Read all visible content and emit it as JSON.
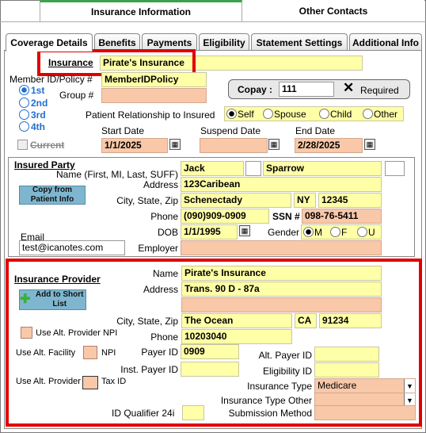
{
  "top_tabs": [
    "Insurance Information",
    "Other Contacts"
  ],
  "sub_tabs": [
    "Coverage Details",
    "Benefits",
    "Payments",
    "Eligibility",
    "Statement Settings",
    "Additional Info"
  ],
  "insurance": {
    "label": "Insurance",
    "value": "Pirate's Insurance"
  },
  "member": {
    "label": "Member ID/Policy #",
    "value": "MemberIDPolicy",
    "group_label": "Group #",
    "priorities": [
      "1st",
      "2nd",
      "3rd",
      "4th"
    ],
    "selected_priority": "1st"
  },
  "copay": {
    "label": "Copay :",
    "value": "111",
    "required_label": "Required",
    "x_icon": "close-icon"
  },
  "relationship": {
    "label": "Patient Relationship to Insured",
    "options": [
      "Self",
      "Spouse",
      "Child",
      "Other"
    ],
    "selected": "Self"
  },
  "dates": {
    "current_label": "Current",
    "start_label": "Start Date",
    "start_value": "1/1/2025",
    "suspend_label": "Suspend Date",
    "suspend_value": "",
    "end_label": "End Date",
    "end_value": "2/28/2025"
  },
  "insured_party": {
    "title": "Insured Party",
    "name_label": "Name (First, MI, Last, SUFF)",
    "first": "Jack",
    "mi": "",
    "last": "Sparrow",
    "suffix": "",
    "copy_button": "Copy from Patient Info",
    "address_label": "Address",
    "address": "123Caribean",
    "csz_label": "City, State, Zip",
    "city": "Schenectady",
    "state": "NY",
    "zip": "12345",
    "phone_label": "Phone",
    "phone": "(090)909-0909",
    "ssn_label": "SSN #",
    "ssn": "098-76-5411",
    "dob_label": "DOB",
    "dob": "1/1/1995",
    "gender_label": "Gender",
    "genders": [
      "M",
      "F",
      "U"
    ],
    "gender_selected": "M",
    "email_label": "Email",
    "email": "test@icanotes.com",
    "employer_label": "Employer",
    "employer": ""
  },
  "provider": {
    "title": "Insurance Provider",
    "add_button": "Add to Short List",
    "name_label": "Name",
    "name": "Pirate's Insurance",
    "address_label": "Address",
    "address1": "Trans. 90 D - 87a",
    "address2": "",
    "csz_label": "City, State, Zip",
    "city": "The Ocean",
    "state": "CA",
    "zip": "91234",
    "phone_label": "Phone",
    "phone": "10203040",
    "alt_npi_label": "Use Alt. Provider NPI",
    "alt_facility_label": "Use Alt. Facility",
    "npi_label": "NPI",
    "alt_provider_label": "Use Alt. Provider",
    "taxid_label": "Tax ID",
    "payer_id_label": "Payer ID",
    "payer_id": "0909",
    "alt_payer_id_label": "Alt. Payer ID",
    "alt_payer_id": "",
    "inst_payer_id_label": "Inst. Payer ID",
    "inst_payer_id": "",
    "eligibility_id_label": "Eligibility ID",
    "eligibility_id": "",
    "ins_type_label": "Insurance Type",
    "ins_type": "Medicare",
    "ins_type_other_label": "Insurance Type Other",
    "ins_type_other": "",
    "id_qualifier_label": "ID Qualifier 24i",
    "id_qualifier": "",
    "submission_label": "Submission Method",
    "submission": ""
  }
}
